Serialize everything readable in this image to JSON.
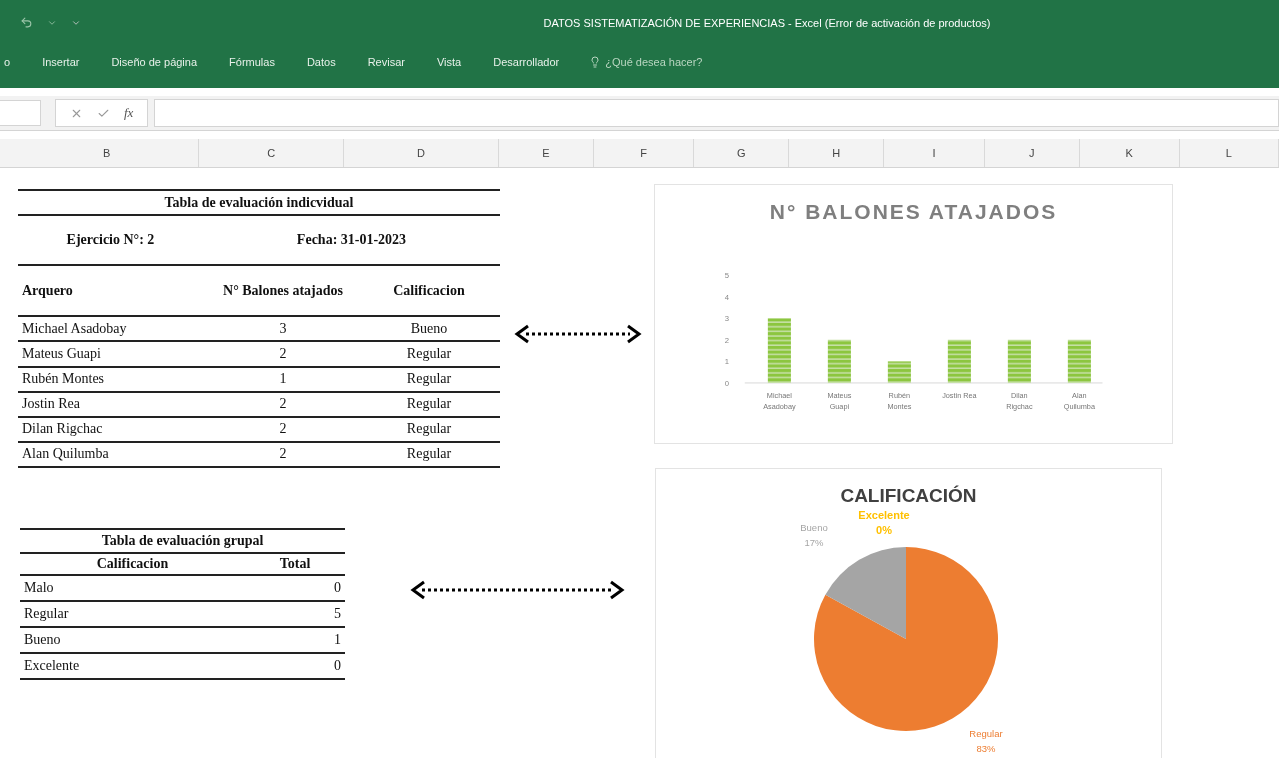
{
  "window": {
    "title": "DATOS SISTEMATIZACIÓN DE EXPERIENCIAS - Excel (Error de activación de productos)"
  },
  "ribbon_tabs": [
    {
      "label": "o",
      "selected": false
    },
    {
      "label": "Insertar",
      "selected": false
    },
    {
      "label": "Diseño de página",
      "selected": false
    },
    {
      "label": "Fórmulas",
      "selected": false
    },
    {
      "label": "Datos",
      "selected": false
    },
    {
      "label": "Revisar",
      "selected": false
    },
    {
      "label": "Vista",
      "selected": false
    },
    {
      "label": "Desarrollador",
      "selected": false
    }
  ],
  "tell_me": {
    "placeholder": "¿Qué desea hacer?"
  },
  "formula_bar": {
    "function_label": "fx"
  },
  "columns": [
    "B",
    "C",
    "D",
    "E",
    "F",
    "G",
    "H",
    "I",
    "J",
    "K",
    "L"
  ],
  "individual_table": {
    "title": "Tabla de evaluación indicvidual",
    "exercise": "Ejercicio N°: 2",
    "date": "Fecha: 31-01-2023",
    "headers": [
      "Arquero",
      "N° Balones atajados",
      "Calificacion"
    ],
    "rows": [
      [
        "Michael Asadobay",
        "3",
        "Bueno"
      ],
      [
        "Mateus Guapi",
        "2",
        "Regular"
      ],
      [
        "Rubén Montes",
        "1",
        "Regular"
      ],
      [
        "Jostin Rea",
        "2",
        "Regular"
      ],
      [
        "Dilan Rigchac",
        "2",
        "Regular"
      ],
      [
        "Alan Quilumba",
        "2",
        "Regular"
      ]
    ]
  },
  "group_table": {
    "title": "Tabla de evaluación grupal",
    "headers": [
      "Calificacion",
      "Total"
    ],
    "rows": [
      [
        "Malo",
        "0"
      ],
      [
        "Regular",
        "5"
      ],
      [
        "Bueno",
        "1"
      ],
      [
        "Excelente",
        "0"
      ]
    ]
  },
  "bar_chart": {
    "chart_data": {
      "type": "bar",
      "title": "N° BALONES ATAJADOS",
      "categories": [
        "Michael Asadobay",
        "Mateus Guapi",
        "Rubén Montes",
        "Jostin Rea",
        "Dilan Rigchac",
        "Alan Quilumba"
      ],
      "series": [
        {
          "color": "#8cc63f",
          "values": [
            3,
            2,
            1,
            2,
            2,
            2
          ]
        }
      ],
      "ylim": [
        0,
        5
      ],
      "yticks": [
        0,
        1,
        2,
        3,
        4,
        5
      ]
    }
  },
  "pie_chart": {
    "chart_data": {
      "type": "pie",
      "title": "CALIFICACIÓN",
      "categories": [
        "Regular",
        "Bueno",
        "Excelente"
      ],
      "values": [
        83,
        17,
        0
      ],
      "value_labels": [
        "83%",
        "17%",
        "0%"
      ]
    },
    "slices": [
      {
        "color": "#ed7d31"
      },
      {
        "color": "#a5a5a5"
      },
      {
        "color": "#ffc000"
      }
    ]
  }
}
